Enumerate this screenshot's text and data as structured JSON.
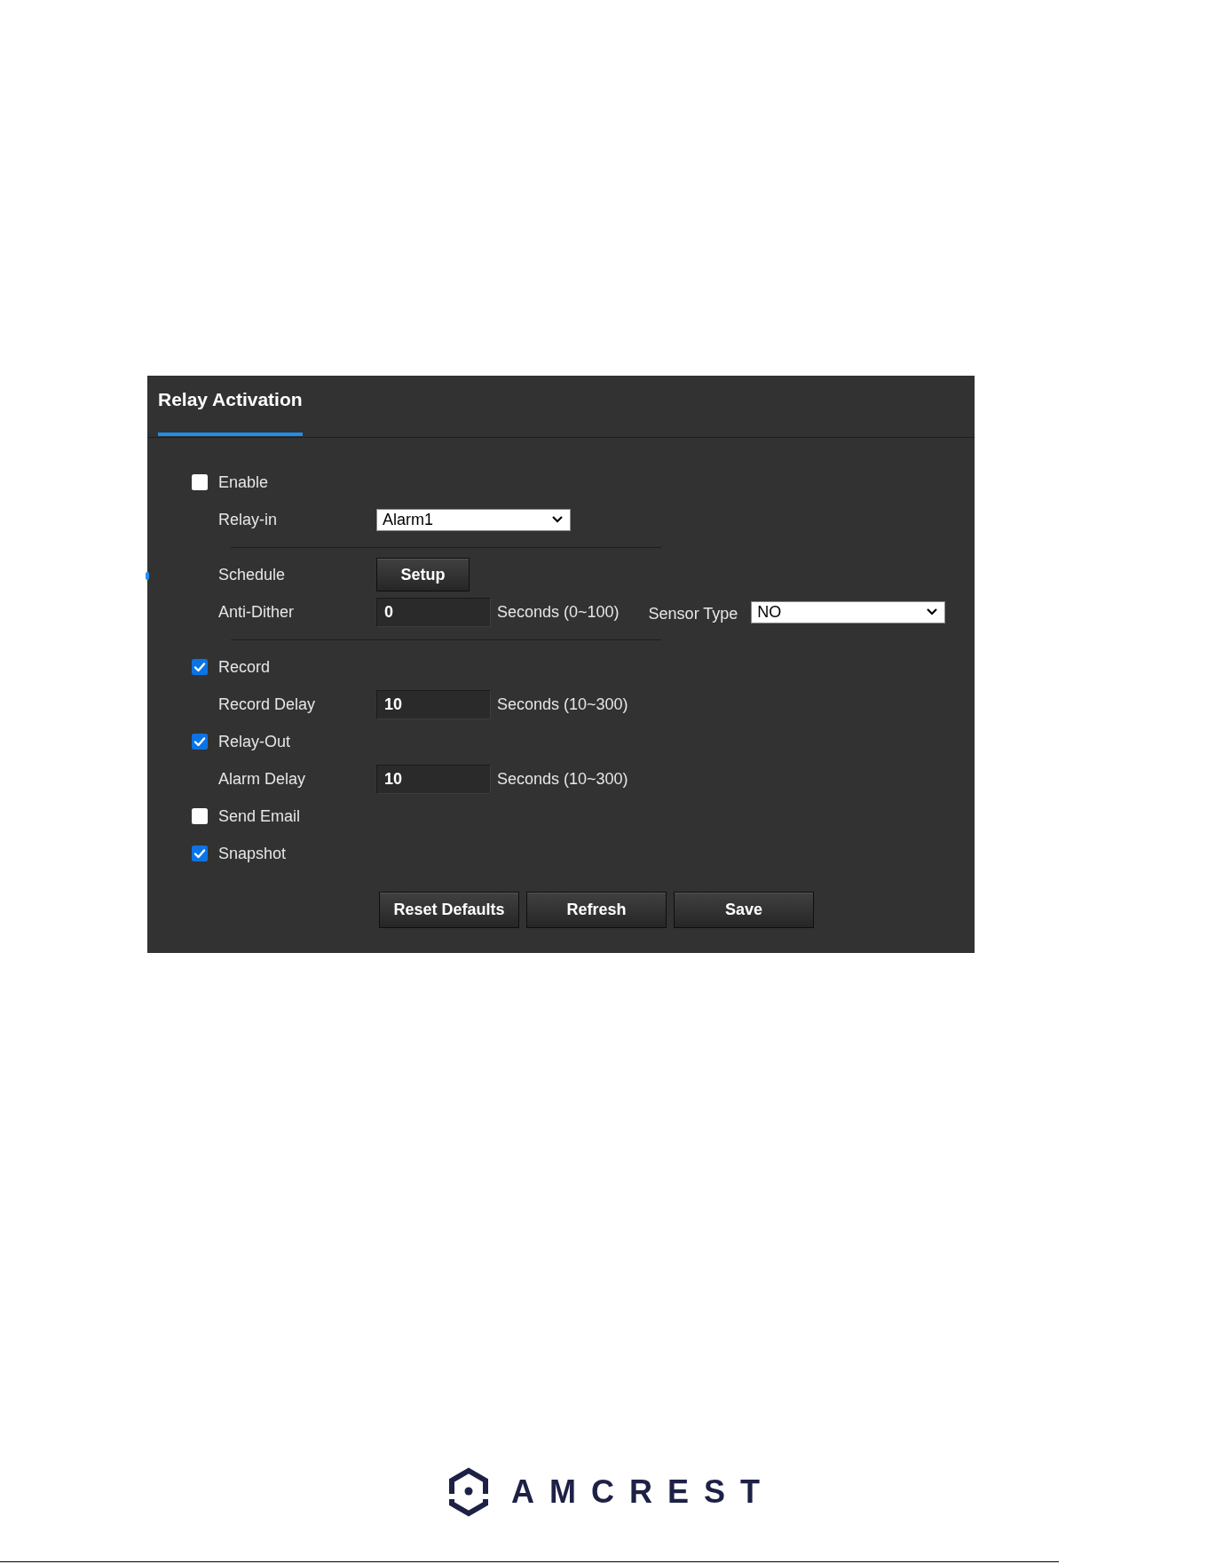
{
  "panel": {
    "tab": {
      "label": "Relay Activation",
      "selected": true
    }
  },
  "rows": [
    {
      "kind": "checkbox",
      "label": "Enable",
      "checked": false
    },
    {
      "kind": "select",
      "label": "Relay-in",
      "value": "Alarm1"
    },
    {
      "kind": "divider"
    },
    {
      "kind": "button",
      "label": "Schedule",
      "button": "Setup"
    },
    {
      "kind": "number",
      "label": "Anti-Dither",
      "value": "0",
      "unit": "Seconds (0~100)",
      "sensor_type": {
        "label": "Sensor Type",
        "value": "NO"
      }
    },
    {
      "kind": "divider"
    },
    {
      "kind": "checkbox",
      "label": "Record",
      "checked": true
    },
    {
      "kind": "number",
      "label": "Record Delay",
      "value": "10",
      "unit": "Seconds (10~300)"
    },
    {
      "kind": "checkbox",
      "label": "Relay-Out",
      "checked": true
    },
    {
      "kind": "number",
      "label": "Alarm Delay",
      "value": "10",
      "unit": "Seconds (10~300)"
    },
    {
      "kind": "checkbox",
      "label": "Send Email",
      "checked": false
    },
    {
      "kind": "checkbox",
      "label": "Snapshot",
      "checked": true
    }
  ],
  "buttons": [
    {
      "label": "Reset Defaults"
    },
    {
      "label": "Refresh"
    },
    {
      "label": "Save"
    }
  ],
  "footer": {
    "logo": "AMCREST"
  }
}
